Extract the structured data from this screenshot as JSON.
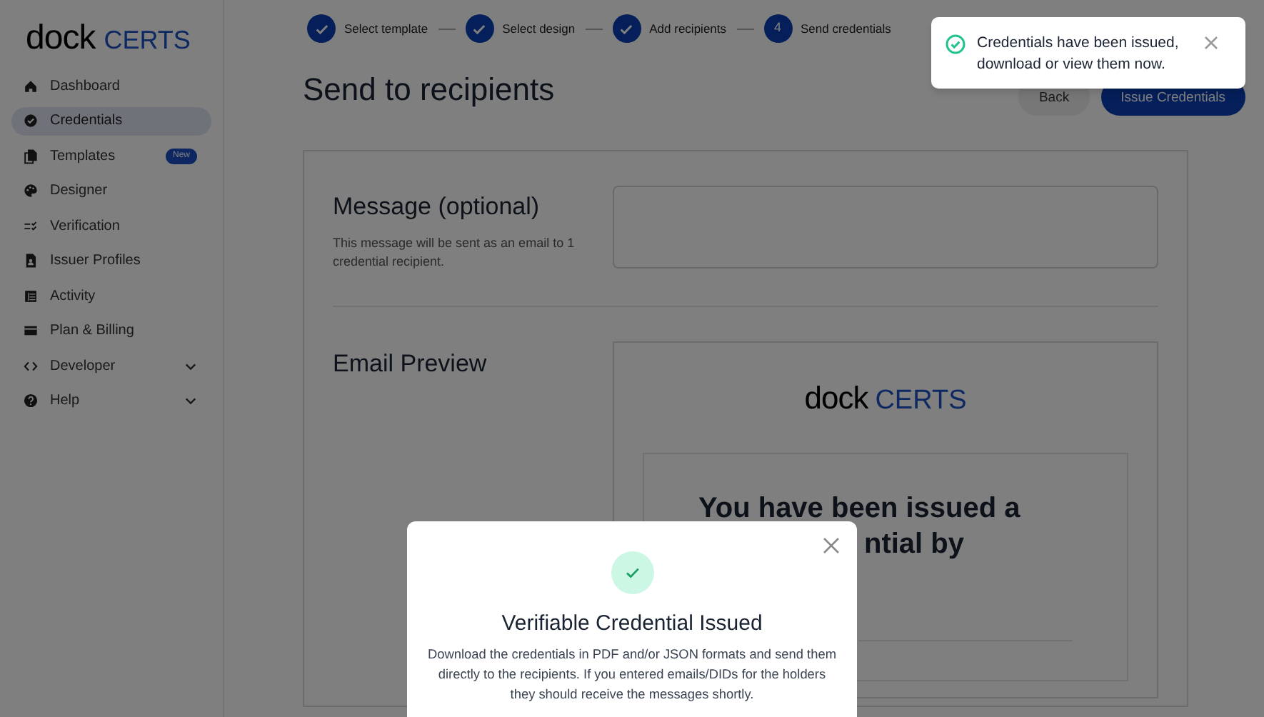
{
  "logo": {
    "word": "dock",
    "brand": "CERTS"
  },
  "sidebar": {
    "items": [
      {
        "label": "Dashboard",
        "selected": false
      },
      {
        "label": "Credentials",
        "selected": true
      },
      {
        "label": "Templates",
        "selected": false,
        "badge": "New"
      },
      {
        "label": "Designer",
        "selected": false
      },
      {
        "label": "Verification",
        "selected": false
      },
      {
        "label": "Issuer Profiles",
        "selected": false
      },
      {
        "label": "Activity",
        "selected": false
      },
      {
        "label": "Plan & Billing",
        "selected": false
      },
      {
        "label": "Developer",
        "selected": false,
        "expanded": false
      },
      {
        "label": "Help",
        "selected": false,
        "expanded": false
      }
    ]
  },
  "stepper": [
    {
      "label": "Select template",
      "done": true
    },
    {
      "label": "Select design",
      "done": true
    },
    {
      "label": "Add recipients",
      "done": true
    },
    {
      "label": "Send credentials",
      "done": false,
      "number": "4"
    }
  ],
  "page_title": "Send to recipients",
  "buttons": [
    {
      "label": "Back",
      "kind": "secondary"
    },
    {
      "label": "Issue Credentials",
      "kind": "primary"
    }
  ],
  "message": {
    "title": "Message (optional)",
    "hint": "This message will be sent as an email to 1 credential recipient."
  },
  "email_preview": {
    "title": "Email Preview",
    "logo": {
      "word": "dock",
      "brand": "CERTS"
    },
    "heading_lines": [
      "You have been issued a",
      "ntial by"
    ]
  },
  "toast": {
    "text": "Credentials have been issued, download or view them now."
  },
  "modal": {
    "title": "Verifiable Credential Issued",
    "body": "Download the credentials in PDF and/or JSON formats and send them directly to the recipients. If you entered emails/DIDs for the holders they should receive the messages shortly."
  }
}
